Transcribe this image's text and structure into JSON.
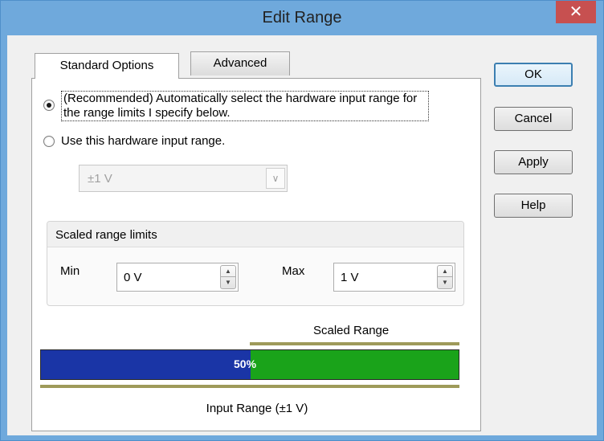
{
  "window": {
    "title": "Edit Range",
    "close_glyph": "✕"
  },
  "tabs": [
    {
      "label": "Standard Options",
      "active": true
    },
    {
      "label": "Advanced",
      "active": false
    }
  ],
  "options": {
    "recommended_label": "(Recommended) Automatically select the hardware input range for the range limits I specify below.",
    "recommended_selected": true,
    "manual_label": "Use this hardware input range.",
    "manual_selected": false,
    "hw_range_value": "±1 V"
  },
  "scaled_limits": {
    "title": "Scaled range limits",
    "min_label": "Min",
    "min_value": "0 V",
    "max_label": "Max",
    "max_value": "1 V"
  },
  "range_bar": {
    "scaled_label": "Scaled Range",
    "percent_text": "50%",
    "scaled_start_fraction": 0.5,
    "input_label": "Input Range (±1 V)",
    "colors": {
      "input": "#1a35a6",
      "scaled": "#1aa31a",
      "marker": "#9e9a5a"
    }
  },
  "buttons": {
    "ok": "OK",
    "cancel": "Cancel",
    "apply": "Apply",
    "help": "Help"
  },
  "icons": {
    "spin_up": "▲",
    "spin_down": "▼",
    "dropdown": "∨"
  }
}
